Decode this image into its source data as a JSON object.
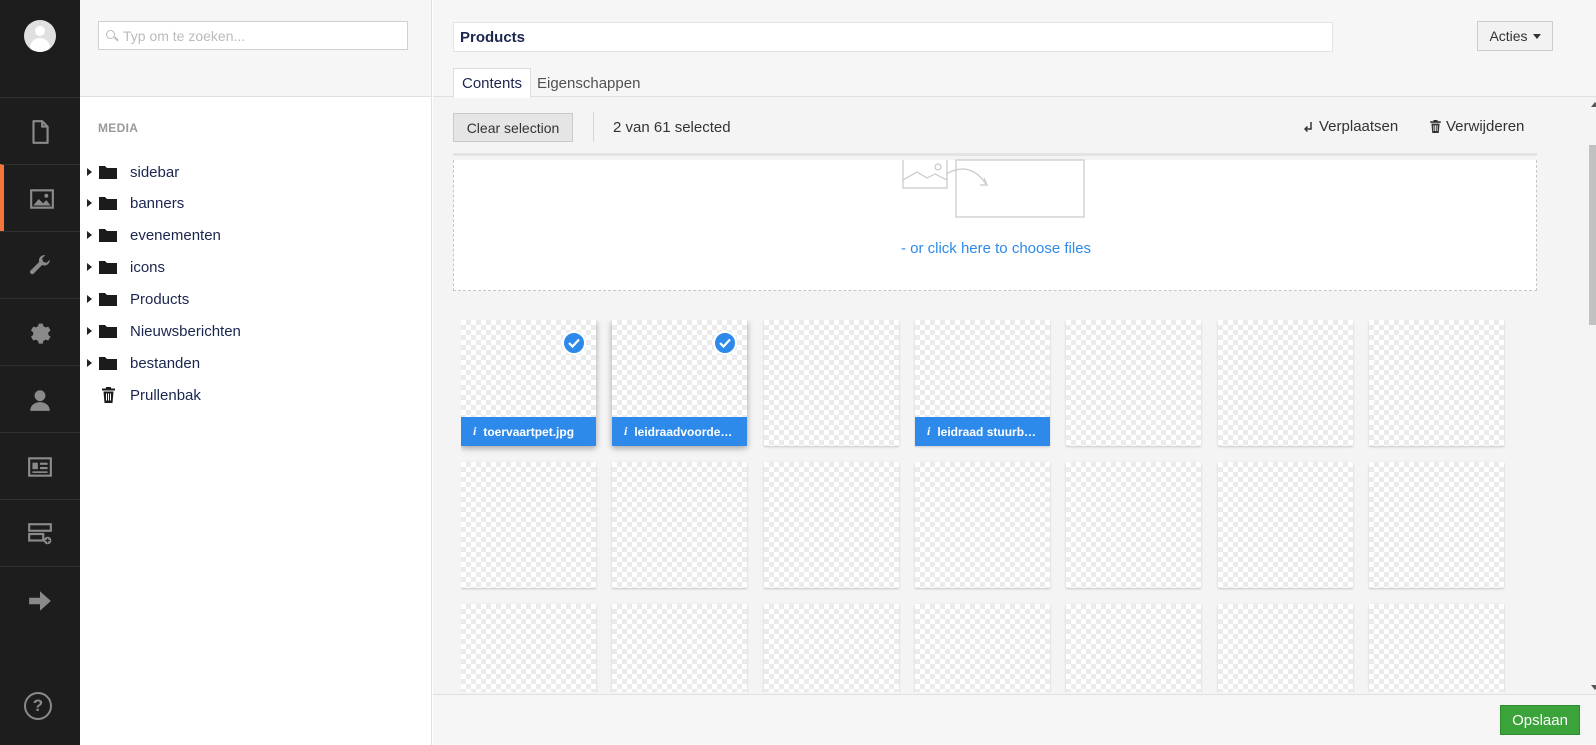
{
  "appbar": {
    "items": [
      {
        "icon": "content-icon"
      },
      {
        "icon": "media-icon",
        "active": true
      },
      {
        "icon": "wrench-icon"
      },
      {
        "icon": "gear-icon"
      },
      {
        "icon": "user-icon"
      },
      {
        "icon": "member-card-icon"
      },
      {
        "icon": "forms-icon"
      },
      {
        "icon": "arrow-right-icon"
      }
    ],
    "help_label": "?",
    "accent_color": "#f5763b"
  },
  "tree": {
    "search_placeholder": "Typ om te zoeken...",
    "section_label": "MEDIA",
    "items": [
      {
        "label": "sidebar",
        "type": "folder"
      },
      {
        "label": "banners",
        "type": "folder"
      },
      {
        "label": "evenementen",
        "type": "folder"
      },
      {
        "label": "icons",
        "type": "folder"
      },
      {
        "label": "Products",
        "type": "folder"
      },
      {
        "label": "Nieuwsberichten",
        "type": "folder"
      },
      {
        "label": "bestanden",
        "type": "folder"
      },
      {
        "label": "Prullenbak",
        "type": "trash"
      }
    ]
  },
  "header": {
    "title_value": "Products",
    "acties_label": "Acties",
    "tabs": [
      {
        "label": "Contents",
        "active": true
      },
      {
        "label": "Eigenschappen",
        "active": false
      }
    ]
  },
  "selection": {
    "clear_label": "Clear selection",
    "count_text": "2 van 61 selected",
    "move_label": "Verplaatsen",
    "delete_label": "Verwijderen"
  },
  "upload": {
    "choose_text": "- or click here to choose files",
    "link_color": "#2e8aea"
  },
  "grid": {
    "rows": [
      [
        {
          "name": "toervaartpet.jpg",
          "selected": true
        },
        {
          "name": "leidraadvoordey...",
          "selected": true
        },
        {
          "name": "",
          "selected": false
        },
        {
          "name": "leidraad stuurbr...",
          "selected": false
        },
        {
          "name": "",
          "selected": false
        },
        {
          "name": "",
          "selected": false
        },
        {
          "name": "",
          "selected": false
        }
      ],
      [
        {
          "name": "",
          "selected": false
        },
        {
          "name": "",
          "selected": false
        },
        {
          "name": "",
          "selected": false
        },
        {
          "name": "",
          "selected": false
        },
        {
          "name": "",
          "selected": false
        },
        {
          "name": "",
          "selected": false
        },
        {
          "name": "",
          "selected": false
        }
      ],
      [
        {
          "name": "",
          "selected": false
        },
        {
          "name": "",
          "selected": false
        },
        {
          "name": "",
          "selected": false
        },
        {
          "name": "",
          "selected": false
        },
        {
          "name": "",
          "selected": false
        },
        {
          "name": "",
          "selected": false
        },
        {
          "name": "",
          "selected": false
        }
      ]
    ],
    "selection_color": "#2e8aea"
  },
  "footer": {
    "save_label": "Opslaan",
    "save_color": "#3aa43a"
  }
}
